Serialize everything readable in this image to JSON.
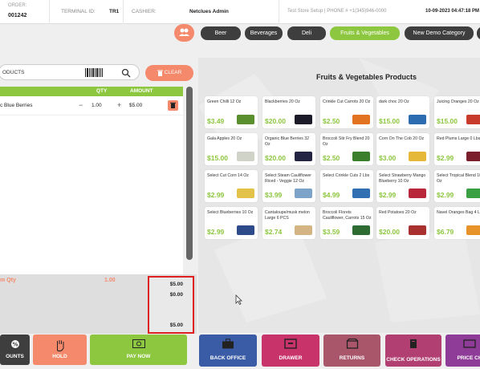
{
  "header": {
    "order_label": "ORDER:",
    "order_number": "001242",
    "terminal_label": "TERMINAL ID:",
    "terminal_value": "TR1",
    "cashier_label": "CASHIER:",
    "cashier_value": "Netclues Admin",
    "store_info": "Test Store Setup | PHONE # +1(345)946-0000",
    "datetime": "10-09-2023 04:47:18 PM"
  },
  "search": {
    "value": "ODUCTS"
  },
  "clear_label": "CLEAR",
  "columns": {
    "qty": "QTY",
    "amount": "AMOUNT"
  },
  "cart_items": [
    {
      "name": "c Blue Berries",
      "qty": "1.00",
      "amount": "$5.00"
    }
  ],
  "summary": {
    "label": "m Qty",
    "qty": "1.00",
    "values": [
      "$5.00",
      "$0.00",
      "$5.00"
    ]
  },
  "left_buttons": {
    "discounts": "OUNTS",
    "hold": "HOLD",
    "pay_now": "PAY NOW"
  },
  "categories": [
    "Beer",
    "Beverages",
    "Deli",
    "Fruits & Vegetables",
    "New Demo Category"
  ],
  "active_category": "Fruits & Vegetables",
  "panel_title": "Fruits & Vegetables Products",
  "products": [
    {
      "name": "Green Chilli 12 Oz",
      "price": "$3.49",
      "img": "#5a8f2e"
    },
    {
      "name": "Blackberries 20 Oz",
      "price": "$20.00",
      "img": "#1b1b2a"
    },
    {
      "name": "Crinkle Cut Carrots 20 Oz",
      "price": "$2.50",
      "img": "#e27320"
    },
    {
      "name": "dark choc 20 Oz",
      "price": "$15.00",
      "img": "#2b6cb0"
    },
    {
      "name": "Juicing Oranges 20 Oz",
      "price": "$15.00",
      "img": "#c83a2a"
    },
    {
      "name": "Gala Apples 20 Oz",
      "price": "$15.00",
      "img": "#cfd3c8"
    },
    {
      "name": "Organic Blue Berries 32 Oz",
      "price": "$20.00",
      "img": "#232344"
    },
    {
      "name": "Broccoli Stir Fry Blend 20 Oz",
      "price": "$2.50",
      "img": "#3b7f2c"
    },
    {
      "name": "Corn On The Cob 20 Oz",
      "price": "$3.00",
      "img": "#e6b83a"
    },
    {
      "name": "Red Plums Large 0 Lbs",
      "price": "$2.99",
      "img": "#7a1f2b"
    },
    {
      "name": "Select Cut Corn 14 Oz",
      "price": "$2.99",
      "img": "#e3c24a"
    },
    {
      "name": "Select Steam Cauliflower Riced - Veggie 12 Oz",
      "price": "$3.99",
      "img": "#7da3c9"
    },
    {
      "name": "Select Crinkle Cuts 2 Lbs",
      "price": "$4.99",
      "img": "#2f6fb2"
    },
    {
      "name": "Select Strawberry Mango Blueberry 10 Oz",
      "price": "$2.99",
      "img": "#b8283a"
    },
    {
      "name": "Select Tropical Blend 10 Oz",
      "price": "$2.99",
      "img": "#3aa043"
    },
    {
      "name": "Select Blueberries 10 Oz",
      "price": "$2.99",
      "img": "#2d4a8a"
    },
    {
      "name": "Cantaloupe/musk melon Large 6 PCS",
      "price": "$2.74",
      "img": "#d4b483"
    },
    {
      "name": "Broccoli Florets Cauliflower, Carrots 15 Oz",
      "price": "$3.59",
      "img": "#2e6b33"
    },
    {
      "name": "Red Potatoes 20 Oz",
      "price": "$20.00",
      "img": "#a8302e"
    },
    {
      "name": "Navel Oranges Bag 4 Lbs",
      "price": "$6.79",
      "img": "#e8922a"
    }
  ],
  "bottom_buttons": {
    "back_office": "BACK OFFICE",
    "drawer": "DRAWER",
    "returns": "RETURNS",
    "check_operations": "CHECK OPERATIONS",
    "price_check": "PRICE CH"
  },
  "colors": {
    "accent_green": "#8dc63f",
    "accent_orange": "#f4896c",
    "dark": "#3e3e3e",
    "back_office": "#3a5ba6",
    "drawer": "#c8336a",
    "returns": "#a9566b",
    "check_operations": "#b13f72",
    "price_check": "#8e3c97"
  }
}
